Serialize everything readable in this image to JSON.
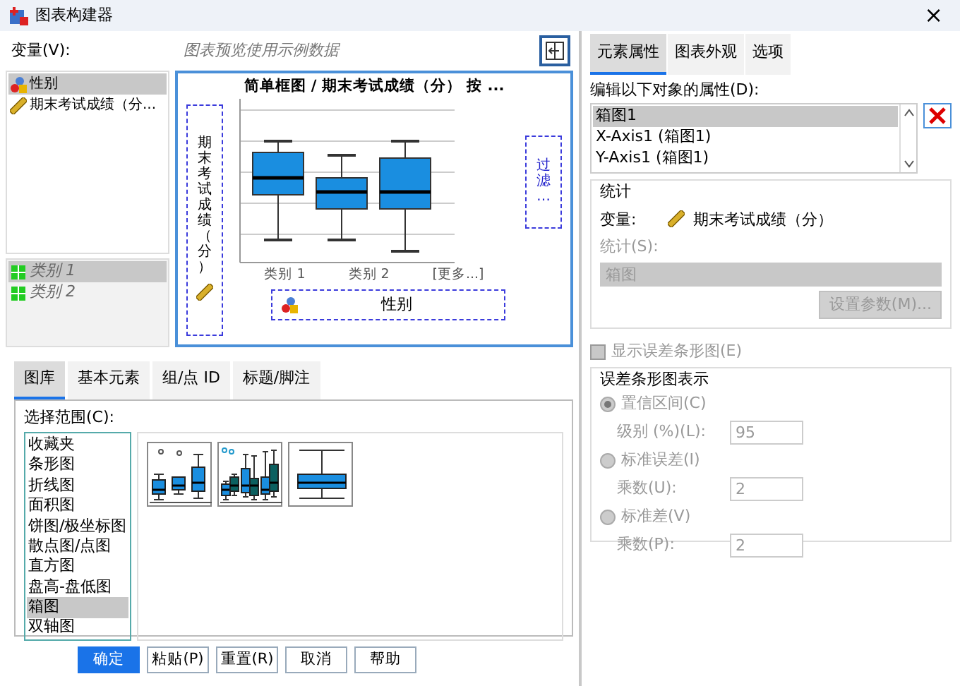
{
  "window": {
    "title": "图表构建器",
    "close": "×"
  },
  "variables": {
    "label": "变量(V):",
    "items": [
      {
        "name": "性别",
        "kind": "nominal",
        "selected": true
      },
      {
        "name": "期末考试成绩（分...",
        "kind": "scale",
        "selected": false
      }
    ]
  },
  "categories": [
    {
      "name": "类别 1",
      "selected": true
    },
    {
      "name": "类别 2",
      "selected": false
    }
  ],
  "preview": {
    "note": "图表预览使用示例数据",
    "title": "简单框图 / 期末考试成绩（分） 按 ...",
    "y_axis": "期末考试成绩（分）",
    "x_axis": "性别",
    "x_labels": [
      "类别 1",
      "类别 2",
      "[更多...]"
    ],
    "filter_zone": "过滤…"
  },
  "gallery_tabs": [
    {
      "label": "图库",
      "selected": true
    },
    {
      "label": "基本元素",
      "selected": false
    },
    {
      "label": "组/点 ID",
      "selected": false
    },
    {
      "label": "标题/脚注",
      "selected": false
    }
  ],
  "gallery": {
    "label": "选择范围(C):",
    "types": [
      {
        "label": "收藏夹",
        "selected": false
      },
      {
        "label": "条形图",
        "selected": false
      },
      {
        "label": "折线图",
        "selected": false
      },
      {
        "label": "面积图",
        "selected": false
      },
      {
        "label": "饼图/极坐标图",
        "selected": false
      },
      {
        "label": "散点图/点图",
        "selected": false
      },
      {
        "label": "直方图",
        "selected": false
      },
      {
        "label": "盘高-盘低图",
        "selected": false
      },
      {
        "label": "箱图",
        "selected": true
      },
      {
        "label": "双轴图",
        "selected": false
      }
    ],
    "thumbnails": [
      {
        "kind": "simple"
      },
      {
        "kind": "clustered"
      },
      {
        "kind": "one-d"
      }
    ]
  },
  "buttons": [
    {
      "label": "确定",
      "kind": "primary"
    },
    {
      "label": "粘贴(P)",
      "kind": "default"
    },
    {
      "label": "重置(R)",
      "kind": "default"
    },
    {
      "label": "取消",
      "kind": "default"
    },
    {
      "label": "帮助",
      "kind": "default"
    }
  ],
  "properties": {
    "tabs": [
      {
        "label": "元素属性",
        "selected": true
      },
      {
        "label": "图表外观",
        "selected": false
      },
      {
        "label": "选项",
        "selected": false
      }
    ],
    "label": "编辑以下对象的属性(D):",
    "objects": [
      {
        "label": "箱图1",
        "selected": true
      },
      {
        "label": "X-Axis1 (箱图1)",
        "selected": false
      },
      {
        "label": "Y-Axis1 (箱图1)",
        "selected": false
      }
    ],
    "statistics": {
      "legend": "统计",
      "variable_label": "变量:",
      "variable": "期末考试成绩（分）",
      "stat_label": "统计(S):",
      "stat_value": "箱图",
      "params_button": "设置参数(M)...",
      "disabled": true
    },
    "error_bars": {
      "label": "显示误差条形图(E)",
      "checked": false,
      "disabled": true
    },
    "error_repr": {
      "legend": "误差条形图表示",
      "disabled": true,
      "options": [
        {
          "label": "置信区间(C)",
          "selected": true,
          "field_label": "级别 (%)(L):",
          "value": "95"
        },
        {
          "label": "标准误差(I)",
          "selected": false,
          "field_label": "乘数(U):",
          "value": "2"
        },
        {
          "label": "标准差(V)",
          "selected": false,
          "field_label": "乘数(P):",
          "value": "2"
        }
      ]
    }
  }
}
